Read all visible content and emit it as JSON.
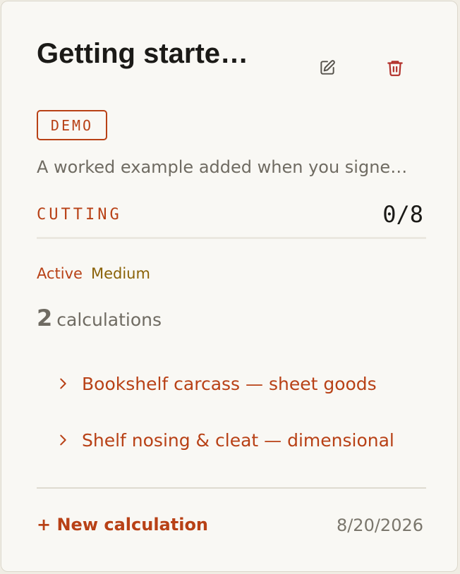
{
  "card": {
    "title": "Getting starte…",
    "badge": "DEMO",
    "description": "A worked example added when you signe…",
    "stage": {
      "label": "CUTTING",
      "count": "0/8"
    },
    "status": {
      "state": "Active",
      "level": "Medium"
    },
    "calculations": {
      "count": "2",
      "label": "calculations",
      "items": [
        {
          "label": "Bookshelf carcass — sheet goods",
          "icon": "chevron-right-icon"
        },
        {
          "label": "Shelf nosing & cleat — dimensional",
          "icon": "chevron-right-icon"
        }
      ]
    },
    "footer": {
      "new_calc_label": "+ New calculation",
      "date": "8/20/2026"
    },
    "icons": {
      "edit": "edit-icon",
      "delete": "trash-icon"
    }
  },
  "colors": {
    "accent": "#b84116",
    "delete": "#b2302a",
    "medium": "#8a6208",
    "title": "#1b1a17",
    "muted": "#6f6b62",
    "card_bg": "#f9f8f4"
  }
}
